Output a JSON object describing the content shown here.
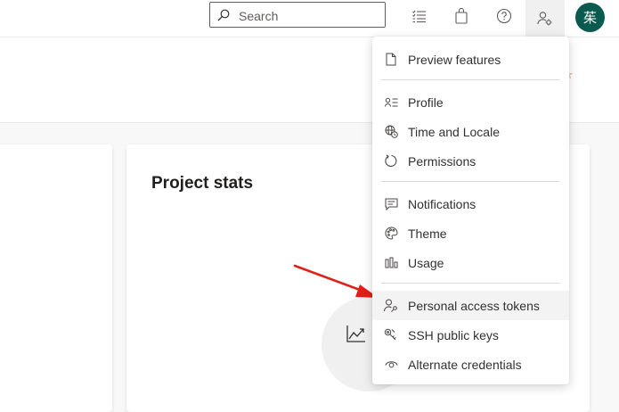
{
  "search": {
    "placeholder": "Search"
  },
  "user": {
    "avatar_initial": "茱"
  },
  "card": {
    "title": "Project stats"
  },
  "menu": {
    "items": [
      {
        "label": "Preview features",
        "icon": "document-icon"
      },
      {
        "label": "Profile",
        "icon": "profile-card-icon"
      },
      {
        "label": "Time and Locale",
        "icon": "globe-clock-icon"
      },
      {
        "label": "Permissions",
        "icon": "refresh-icon"
      },
      {
        "label": "Notifications",
        "icon": "comment-icon"
      },
      {
        "label": "Theme",
        "icon": "palette-icon"
      },
      {
        "label": "Usage",
        "icon": "bar-chart-icon"
      },
      {
        "label": "Personal access tokens",
        "icon": "user-key-icon"
      },
      {
        "label": "SSH public keys",
        "icon": "keys-icon"
      },
      {
        "label": "Alternate credentials",
        "icon": "eye-icon"
      }
    ]
  },
  "colors": {
    "avatar_bg": "#0b5a4f",
    "annotation_arrow": "#e0201a",
    "menu_hover_bg": "#f3f3f3"
  }
}
